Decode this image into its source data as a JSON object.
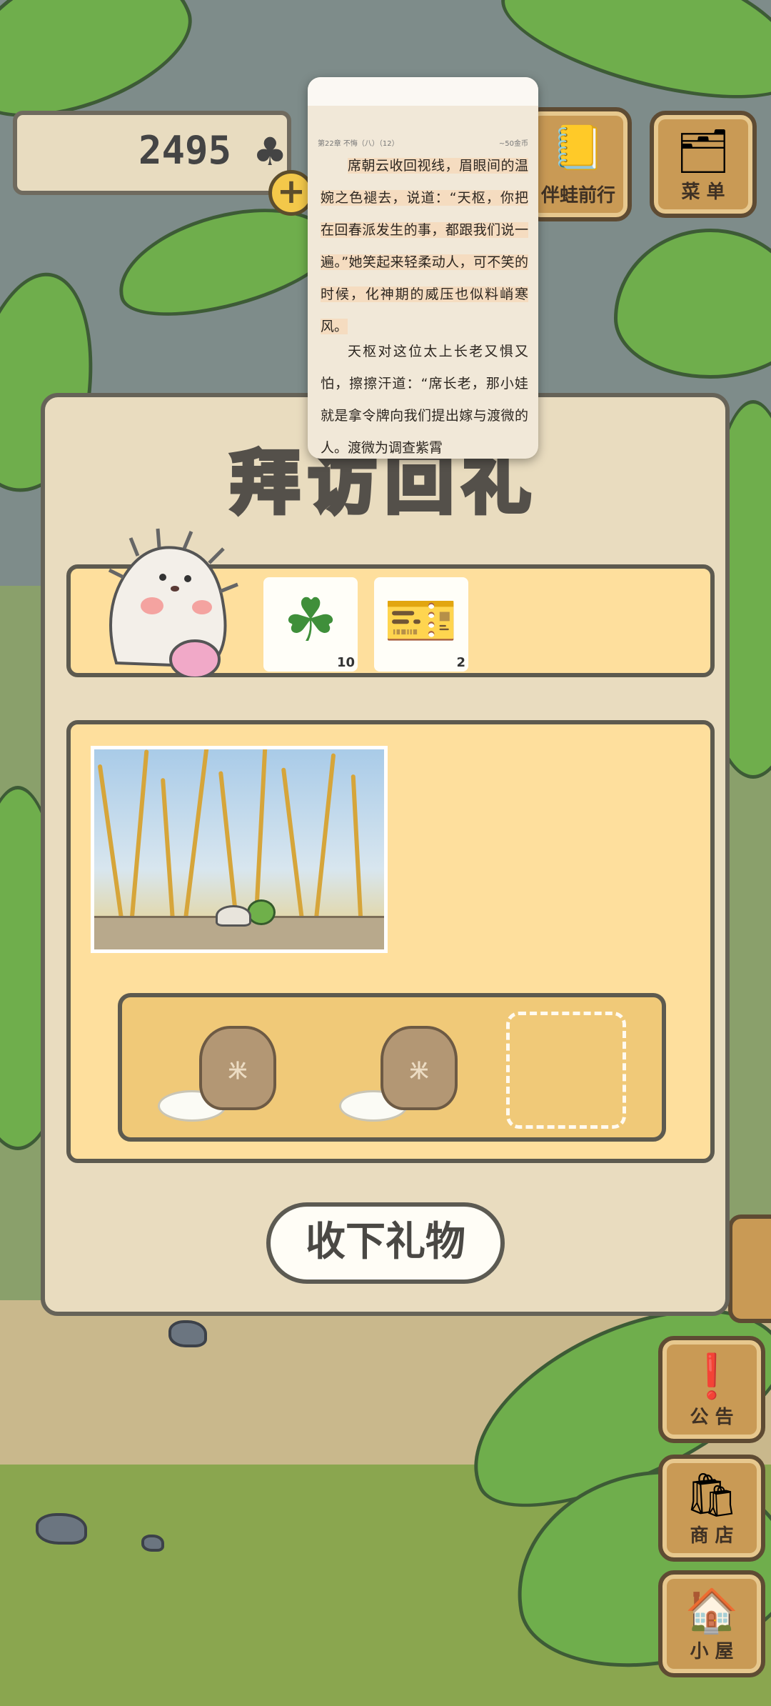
{
  "currency": {
    "amount": "2495",
    "symbol": "♣",
    "add_label": "+"
  },
  "top_buttons": {
    "travel": "伴蛙前行",
    "menu": "菜 单"
  },
  "side_buttons": {
    "notice": "公 告",
    "shop": "商 店",
    "house": "小 屋"
  },
  "panel": {
    "title": "拜访回礼",
    "gifts": [
      {
        "icon": "four-leaf-clover",
        "count": "10"
      },
      {
        "icon": "ticket",
        "count": "2"
      }
    ],
    "slot_items": [
      {
        "icon": "rice-bag",
        "bag_label": "米"
      },
      {
        "icon": "rice-bag",
        "bag_label": "米"
      }
    ],
    "accept_label": "收下礼物"
  },
  "reader": {
    "chapter": "第22章 不悔（八）（12）",
    "coins": "~50金币",
    "paragraph1": "席朝云收回视线，眉眼间的温婉之色褪去，说道：“天枢，你把在回春派发生的事，都跟我们说一遍。”她笑起来轻柔动人，可不笑的时候，化神期的威压也似料峭寒风。",
    "paragraph2": "天枢对这位太上长老又惧又怕，擦擦汗道：“席长老，那小娃就是拿令牌向我们提出嫁与渡微的人。渡微为调查紫霄"
  },
  "colors": {
    "panel_bg": "#e9dcbf",
    "card_bg": "#fedf9d",
    "slot_bg": "#f0c978",
    "wood": "#c99a55",
    "outline": "#5d5a4f"
  }
}
